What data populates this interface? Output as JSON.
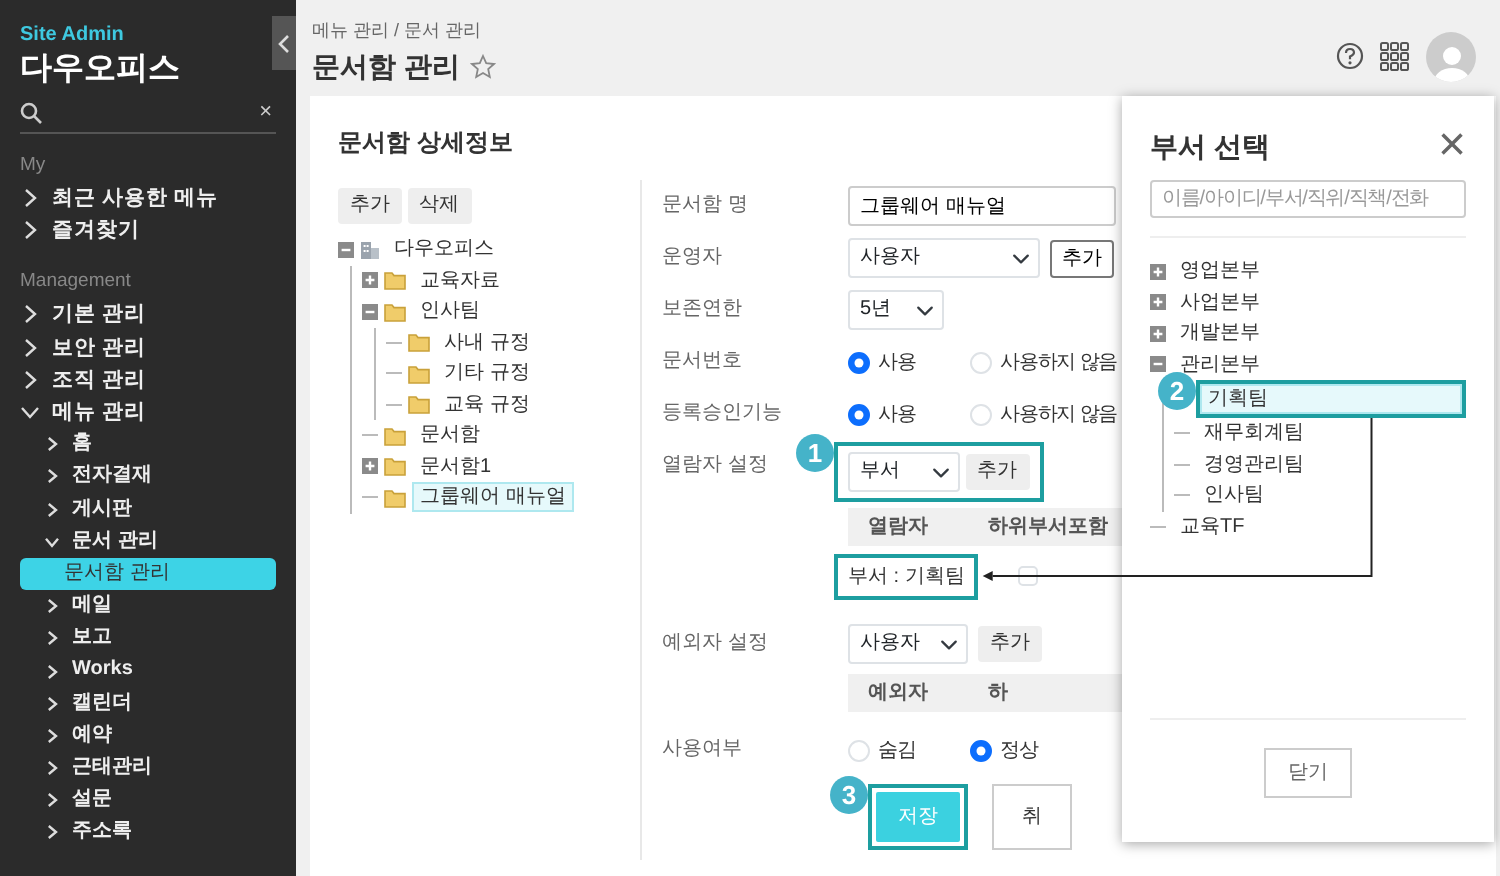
{
  "sidebar": {
    "brand": "Site Admin",
    "title": "다우오피스",
    "search": {
      "clear": "×"
    },
    "sections": [
      {
        "heading": "My",
        "items": [
          {
            "label": "최근 사용한 메뉴",
            "expanded": false,
            "selected": false
          },
          {
            "label": "즐겨찾기",
            "expanded": false,
            "selected": false
          }
        ]
      },
      {
        "heading": "Management",
        "items": [
          {
            "label": "기본 관리",
            "expanded": false,
            "selected": false
          },
          {
            "label": "보안 관리",
            "expanded": false,
            "selected": false
          },
          {
            "label": "조직 관리",
            "expanded": false,
            "selected": false
          },
          {
            "label": "메뉴 관리",
            "expanded": true,
            "selected": false,
            "children": [
              {
                "label": "홈",
                "expanded": false,
                "selected": false
              },
              {
                "label": "전자결재",
                "expanded": false,
                "selected": false
              },
              {
                "label": "게시판",
                "expanded": false,
                "selected": false
              },
              {
                "label": "문서 관리",
                "expanded": true,
                "selected": false,
                "children": [
                  {
                    "label": "문서함 관리",
                    "selected": true
                  }
                ]
              },
              {
                "label": "메일",
                "expanded": false,
                "selected": false
              },
              {
                "label": "보고",
                "expanded": false,
                "selected": false
              },
              {
                "label": "Works",
                "expanded": false,
                "selected": false
              },
              {
                "label": "캘린더",
                "expanded": false,
                "selected": false
              },
              {
                "label": "예약",
                "expanded": false,
                "selected": false
              },
              {
                "label": "근태관리",
                "expanded": false,
                "selected": false
              },
              {
                "label": "설문",
                "expanded": false,
                "selected": false
              },
              {
                "label": "주소록",
                "expanded": false,
                "selected": false
              }
            ]
          }
        ]
      }
    ]
  },
  "header": {
    "breadcrumb": "메뉴 관리 / 문서 관리",
    "title": "문서함 관리",
    "favorite": false
  },
  "card": {
    "title": "문서함 상세정보",
    "tree_buttons": [
      "추가",
      "삭제"
    ],
    "tree": [
      {
        "label": "다우오피스",
        "kind": "org",
        "expanded": true,
        "selected": false,
        "children": [
          {
            "label": "교육자료",
            "kind": "folder",
            "expanded": false,
            "selected": false
          },
          {
            "label": "인사팀",
            "kind": "folder",
            "expanded": true,
            "selected": false,
            "children": [
              {
                "label": "사내 규정",
                "kind": "folder",
                "selected": false
              },
              {
                "label": "기타 규정",
                "kind": "folder",
                "selected": false
              },
              {
                "label": "교육 규정",
                "kind": "folder",
                "selected": false
              }
            ]
          },
          {
            "label": "문서함",
            "kind": "folder",
            "selected": false
          },
          {
            "label": "문서함1",
            "kind": "folder",
            "expanded": false,
            "selected": false
          },
          {
            "label": "그룹웨어 매뉴얼",
            "kind": "folder",
            "selected": true
          }
        ]
      }
    ],
    "form": [
      {
        "label": "문서함 명",
        "kind": "text",
        "value": "그룹웨어 매뉴얼"
      },
      {
        "label": "운영자",
        "kind": "select_add",
        "value": "사용자",
        "button": "추가"
      },
      {
        "label": "보존연한",
        "kind": "select",
        "value": "5년"
      },
      {
        "label": "문서번호",
        "kind": "radio",
        "options": [
          {
            "label": "사용",
            "selected": true
          },
          {
            "label": "사용하지 않음",
            "selected": false
          }
        ]
      },
      {
        "label": "등록승인기능",
        "kind": "radio",
        "options": [
          {
            "label": "사용",
            "selected": true
          },
          {
            "label": "사용하지 않음",
            "selected": false
          }
        ]
      },
      {
        "label": "열람자 설정",
        "kind": "table",
        "value": "부서",
        "button": "추가",
        "callout": "1",
        "columns": [
          "열람자",
          "하위부서포함"
        ],
        "rows": [
          {
            "name": "부서 : 기획팀",
            "highlighted": true,
            "checked": false
          }
        ]
      },
      {
        "label": "예외자 설정",
        "kind": "table",
        "value": "사용자",
        "button": "추가",
        "columns": [
          "예외자",
          "하"
        ]
      },
      {
        "label": "사용여부",
        "kind": "radio",
        "options": [
          {
            "label": "숨김",
            "selected": false
          },
          {
            "label": "정상",
            "selected": true
          }
        ]
      }
    ],
    "actions": [
      {
        "label": "저장",
        "kind": "primary",
        "callout": "3"
      },
      {
        "label": "취",
        "kind": "default"
      }
    ]
  },
  "modal": {
    "title": "부서 선택",
    "close": "×",
    "search": {
      "placeholder": "이름/아이디/부서/직위/직책/전화"
    },
    "tree": [
      {
        "label": "영업본부",
        "expanded": false,
        "selected": false
      },
      {
        "label": "사업본부",
        "expanded": false,
        "selected": false
      },
      {
        "label": "개발본부",
        "expanded": false,
        "selected": false
      },
      {
        "label": "관리본부",
        "expanded": true,
        "selected": false,
        "children": [
          {
            "label": "기획팀",
            "selected": true,
            "callout": "2"
          },
          {
            "label": "재무회계팀",
            "selected": false
          },
          {
            "label": "경영관리팀",
            "selected": false
          },
          {
            "label": "인사팀",
            "selected": false
          }
        ]
      },
      {
        "label": "교육TF",
        "selected": false
      }
    ],
    "button": "닫기"
  }
}
